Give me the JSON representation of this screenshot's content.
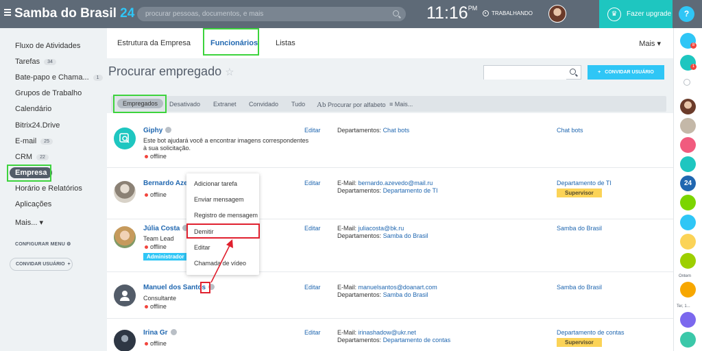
{
  "topbar": {
    "logo_name": "Samba do Brasil",
    "logo_number": "24",
    "search_placeholder": "procurar pessoas, documentos, e mais",
    "time": "11:16",
    "time_suffix": "PM",
    "work_status": "TRABALHANDO",
    "upgrade_label": "Fazer upgrade",
    "help_label": "?"
  },
  "sidebar": {
    "items": [
      {
        "label": "Fluxo de Atividades",
        "count": ""
      },
      {
        "label": "Tarefas",
        "count": "34"
      },
      {
        "label": "Bate-papo e Chama...",
        "count": "1"
      },
      {
        "label": "Grupos de Trabalho",
        "count": ""
      },
      {
        "label": "Calendário",
        "count": ""
      },
      {
        "label": "Bitrix24.Drive",
        "count": ""
      },
      {
        "label": "E-mail",
        "count": "25"
      },
      {
        "label": "CRM",
        "count": "22"
      },
      {
        "label": "Empresa",
        "count": ""
      },
      {
        "label": "Horário e Relatórios",
        "count": ""
      },
      {
        "label": "Aplicações",
        "count": ""
      },
      {
        "label": "Mais... ▾",
        "count": ""
      }
    ],
    "config_menu": "CONFIGURAR MENU",
    "invite_user": "CONVIDAR USUÁRIO"
  },
  "tabs": {
    "items": [
      "Estrutura da Empresa",
      "Funcionários",
      "Listas"
    ],
    "active": "Funcionários",
    "more": "Mais ▾"
  },
  "page": {
    "title": "Procurar empregado",
    "star": "☆",
    "invite_button": "CONVIDAR USUÁRIO"
  },
  "filters": {
    "items": [
      "Empregados",
      "Desativado",
      "Extranet",
      "Convidado",
      "Tudo",
      "Procurar por alfabeto",
      "Mais..."
    ],
    "active": "Empregados",
    "alphabet_prefix": "Ab"
  },
  "employees": [
    {
      "name": "Giphy",
      "desc_line1": "Este bot ajudará você a encontrar imagens correspondentes",
      "desc_line2": "à sua solicitação.",
      "status": "offline",
      "edit": "Editar",
      "email_label": "",
      "email": "",
      "dept_label": "Departamentos:",
      "dept": "Chat bots",
      "right_dept": "Chat bots",
      "badge": ""
    },
    {
      "name": "Bernardo Azevedo",
      "status": "offline",
      "edit": "Editar",
      "email_label": "E-Mail:",
      "email": "bernardo.azevedo@mail.ru",
      "dept_label": "Departamentos:",
      "dept": "Departamento de TI",
      "right_dept": "Departamento de TI",
      "badge": "Supervisor"
    },
    {
      "name": "Júlia Costa",
      "title": "Team Lead",
      "status": "offline",
      "role_badge": "Administrador",
      "edit": "Editar",
      "email_label": "E-Mail:",
      "email": "juliacosta@bk.ru",
      "dept_label": "Departamentos:",
      "dept": "Samba do Brasil",
      "right_dept": "Samba do Brasil",
      "badge": ""
    },
    {
      "name": "Manuel dos Santos",
      "title": "Consultante",
      "status": "offline",
      "edit": "Editar",
      "email_label": "E-Mail:",
      "email": "manuelsantos@doanart.com",
      "dept_label": "Departamentos:",
      "dept": "Samba do Brasil",
      "right_dept": "Samba do Brasil",
      "badge": ""
    },
    {
      "name": "Irina Gr",
      "status": "offline",
      "edit": "Editar",
      "email_label": "E-Mail:",
      "email": "irinashadow@ukr.net",
      "dept_label": "Departamentos:",
      "dept": "Departamento de contas",
      "right_dept": "Departamento de contas",
      "badge": "Supervisor"
    }
  ],
  "popup_menu": {
    "items": [
      "Adicionar tarefa",
      "Enviar mensagem",
      "Registro de mensagem",
      "Demitir",
      "Editar",
      "Chamada de vídeo"
    ]
  },
  "rail": {
    "notif_count": "8",
    "chat_count": "1",
    "label_yesterday": "Ontem",
    "label_day": "Ter, 1..."
  },
  "colors": {
    "topbar": "#5e6a77",
    "accent": "#2fc6f6",
    "link": "#2067b0",
    "upgrade": "#1ec6c0",
    "annotation_green": "#3cd33c",
    "annotation_red": "#e0202e",
    "supervisor_badge": "#fbd357"
  }
}
